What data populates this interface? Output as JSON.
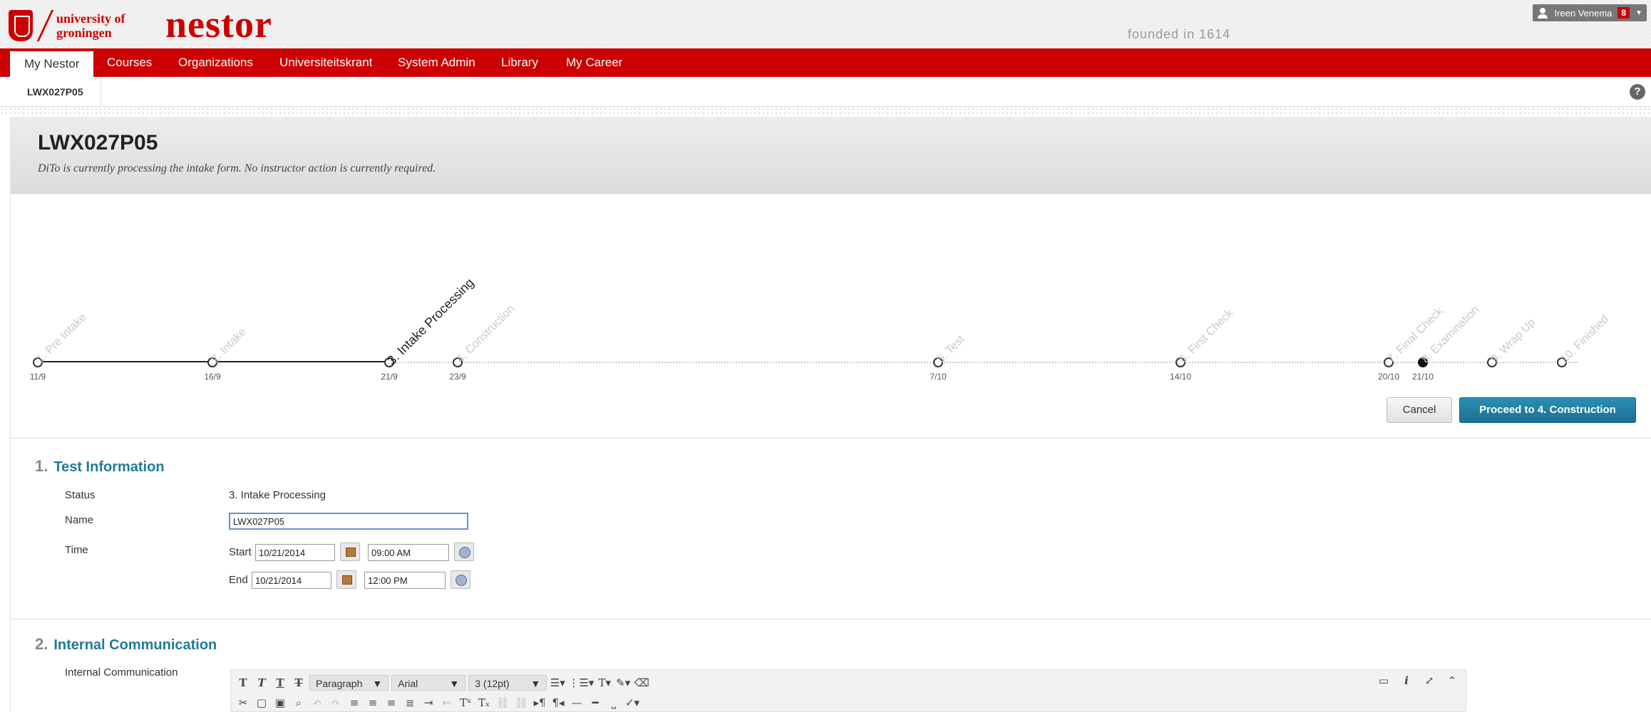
{
  "header": {
    "university_line1": "university of",
    "university_line2": "groningen",
    "brand": "nestor",
    "founded": "founded in 1614",
    "user_name": "Ireen Venema",
    "notification_count": "8"
  },
  "nav": {
    "items": [
      "My Nestor",
      "Courses",
      "Organizations",
      "Universiteitskrant",
      "System Admin",
      "Library",
      "My Career"
    ]
  },
  "subnav": {
    "course_tab": "LWX027P05",
    "help": "?"
  },
  "page": {
    "title": "LWX027P05",
    "subtitle": "DiTo is currently processing the intake form. No instructor action is currently required."
  },
  "timeline": {
    "current_step": "3. Intake Processing",
    "steps": [
      {
        "label": "1. Pre Intake",
        "date": "11/9"
      },
      {
        "label": "2. Intake",
        "date": "16/9"
      },
      {
        "label": "3. Intake Processing",
        "date": "21/9"
      },
      {
        "label": "4. Construction",
        "date": "23/9"
      },
      {
        "label": "5. Test",
        "date": "7/10"
      },
      {
        "label": "6. First Check",
        "date": "14/10"
      },
      {
        "label": "7. Final Check",
        "date": "20/10"
      },
      {
        "label": "8. Examination",
        "date": "21/10"
      },
      {
        "label": "9. Wrap Up",
        "date": ""
      },
      {
        "label": "10. Finished",
        "date": ""
      }
    ]
  },
  "actions": {
    "cancel": "Cancel",
    "proceed": "Proceed to 4. Construction"
  },
  "section1": {
    "number": "1.",
    "title": "Test Information",
    "status_label": "Status",
    "status_value": "3. Intake Processing",
    "name_label": "Name",
    "name_value": "LWX027P05",
    "time_label": "Time",
    "start_label": "Start",
    "start_date": "10/21/2014",
    "start_time": "09:00 AM",
    "end_label": "End",
    "end_date": "10/21/2014",
    "end_time": "12:00 PM"
  },
  "section2": {
    "number": "2.",
    "title": "Internal Communication",
    "field_label": "Internal Communication",
    "toolbar": {
      "format": "Paragraph",
      "font": "Arial",
      "size": "3 (12pt)"
    }
  }
}
